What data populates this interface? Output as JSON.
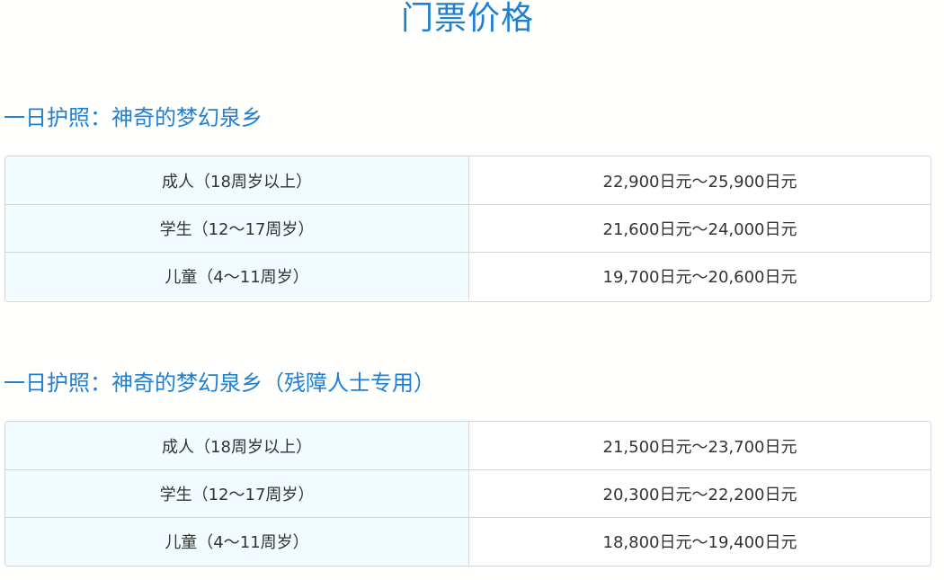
{
  "page_title": "门票价格",
  "sections": [
    {
      "heading": "一日护照：神奇的梦幻泉乡",
      "rows": [
        {
          "label": "成人（18周岁以上）",
          "price": "22,900日元～25,900日元"
        },
        {
          "label": "学生（12～17周岁）",
          "price": "21,600日元～24,000日元"
        },
        {
          "label": "儿童（4～11周岁）",
          "price": "19,700日元～20,600日元"
        }
      ]
    },
    {
      "heading": "一日护照：神奇的梦幻泉乡（残障人士专用）",
      "rows": [
        {
          "label": "成人（18周岁以上）",
          "price": "21,500日元～23,700日元"
        },
        {
          "label": "学生（12～17周岁）",
          "price": "20,300日元～22,200日元"
        },
        {
          "label": "儿童（4～11周岁）",
          "price": "18,800日元～19,400日元"
        }
      ]
    }
  ],
  "colors": {
    "heading": "#1f7fd3",
    "label_cell_bg": "#f2fbff",
    "border": "#cfd6dc",
    "text": "#333333"
  }
}
